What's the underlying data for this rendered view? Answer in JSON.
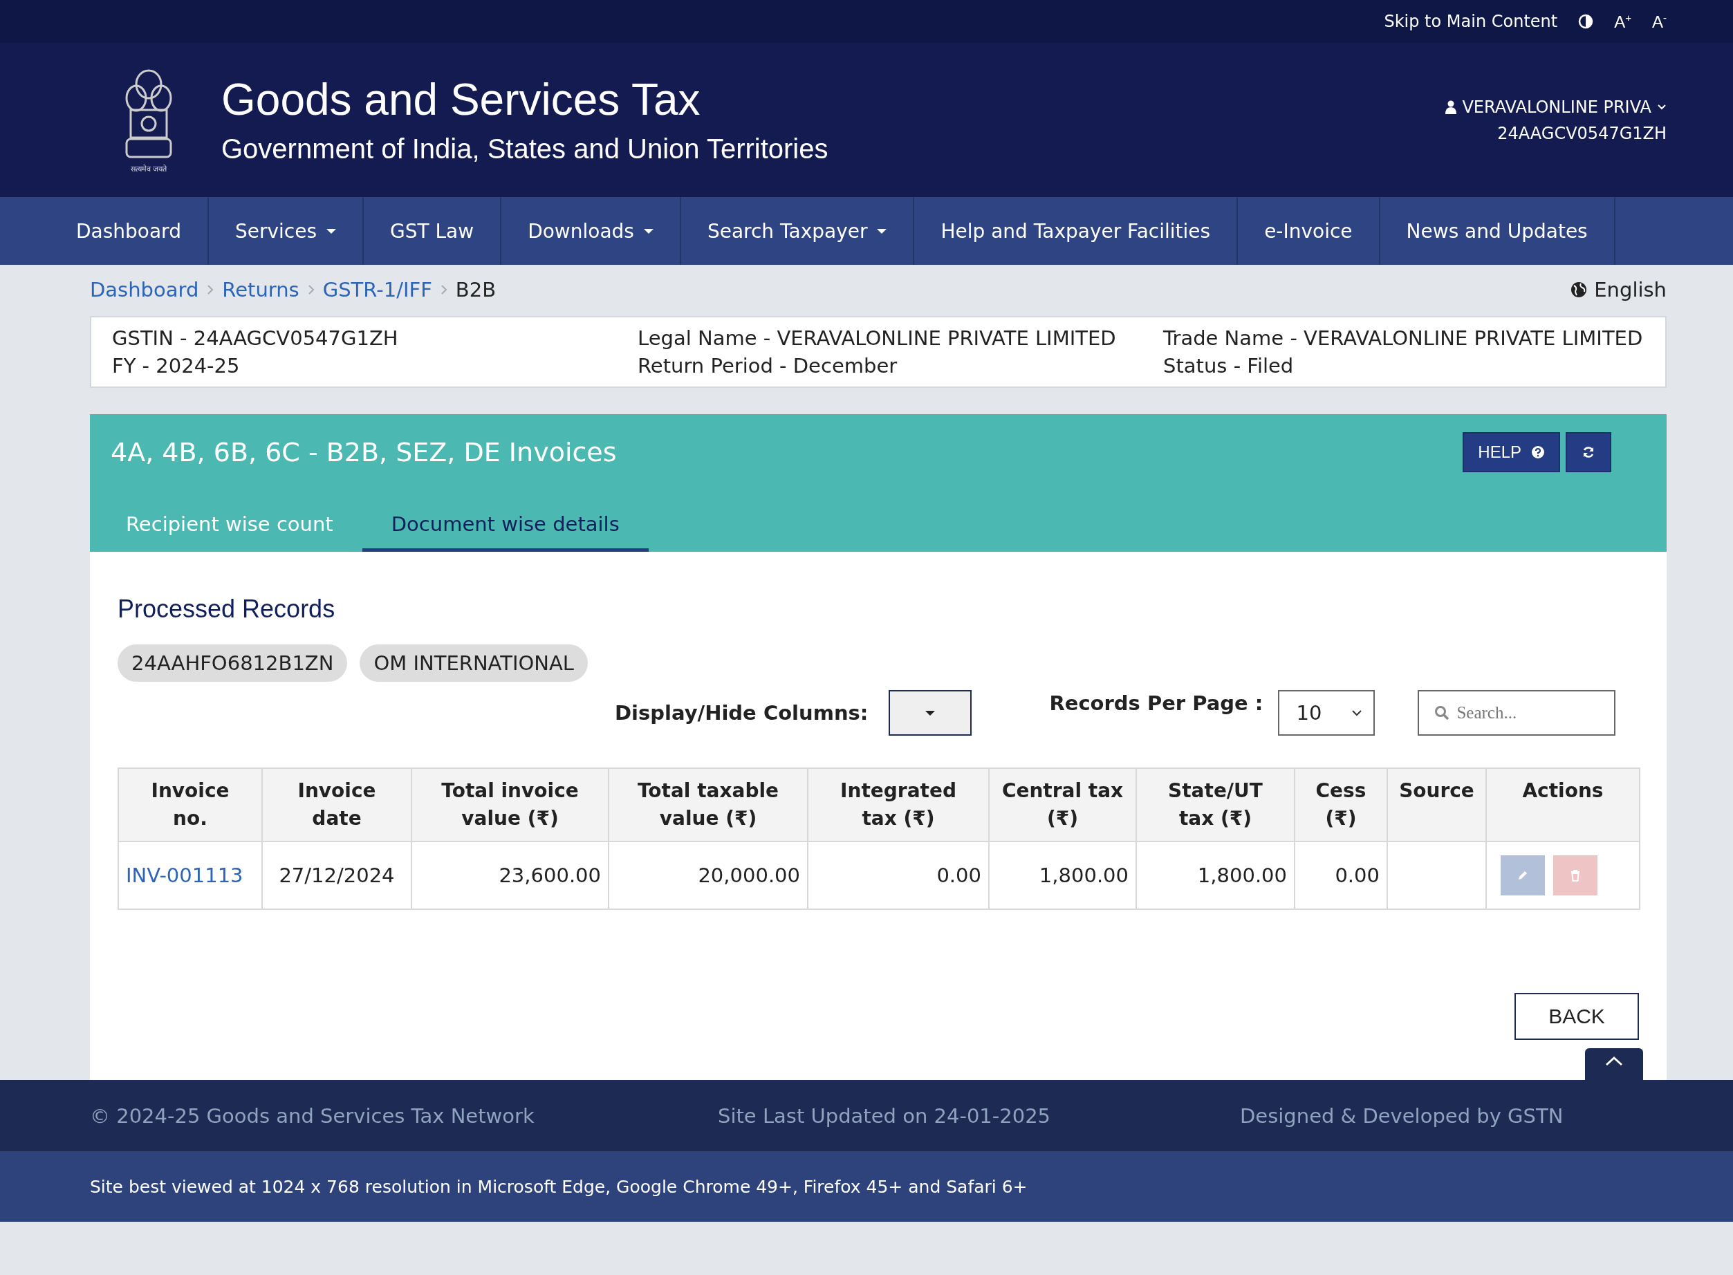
{
  "topbar": {
    "skip_link": "Skip to Main Content",
    "font_sizes": [
      "A$^{+}$",
      "A$^{-}$"
    ]
  },
  "header": {
    "emblem_caption": "सत्यमेव जयते",
    "title": "Goods and Services Tax",
    "subtitle": "Government of India, States and Union Territories",
    "user": {
      "name": "VERAVALONLINE PRIVA",
      "gstin": "24AAGCV0547G1ZH"
    }
  },
  "nav": [
    {
      "label": "Dashboard",
      "dropdown": false
    },
    {
      "label": "Services",
      "dropdown": true
    },
    {
      "label": "GST Law",
      "dropdown": false
    },
    {
      "label": "Downloads",
      "dropdown": true
    },
    {
      "label": "Search Taxpayer",
      "dropdown": true
    },
    {
      "label": "Help and Taxpayer Facilities",
      "dropdown": false
    },
    {
      "label": "e-Invoice",
      "dropdown": false
    },
    {
      "label": "News and Updates",
      "dropdown": false
    }
  ],
  "breadcrumb": {
    "links": [
      "Dashboard",
      "Returns",
      "GSTR-1/IFF"
    ],
    "current": "B2B",
    "language": "English"
  },
  "taxpayer_info": [
    [
      "GSTIN - 24AAGCV0547G1ZH",
      "FY - 2024-25"
    ],
    [
      "Legal Name - VERAVALONLINE PRIVATE LIMITED",
      "Return Period - December"
    ],
    [
      "Trade Name - VERAVALONLINE PRIVATE LIMITED",
      "Status - Filed"
    ]
  ],
  "section": {
    "title": "4A, 4B, 6B, 6C - B2B, SEZ, DE Invoices",
    "help_button": "HELP",
    "tabs": [
      {
        "label": "Recipient wise count",
        "selected": false
      },
      {
        "label": "Document wise details",
        "selected": true
      }
    ]
  },
  "records": {
    "heading": "Processed Records",
    "chips": [
      "24AAHFO6812B1ZN",
      "OM INTERNATIONAL"
    ],
    "display_hide_label": "Display/Hide Columns:",
    "records_per_page_label": "Records Per Page :",
    "records_per_page": "10",
    "search": {
      "placeholder": "Search..."
    }
  },
  "table": {
    "columns": [
      "Invoice no.",
      "Invoice date",
      "Total invoice value (₹)",
      "Total taxable value (₹)",
      "Integrated tax (₹)",
      "Central tax (₹)",
      "State/UT tax (₹)",
      "Cess (₹)",
      "Source",
      "Actions"
    ],
    "rows": [
      {
        "cells": [
          "INV-001113",
          "27/12/2024",
          "23,600.00",
          "20,000.00",
          "0.00",
          "1,800.00",
          "1,800.00",
          "0.00"
        ],
        "actions_disabled": true
      }
    ]
  },
  "back_button": "BACK",
  "footer": {
    "copyright": "© 2024-25 Goods and Services Tax Network",
    "updated": "Site Last Updated on 24-01-2025",
    "designed": "Designed & Developed by GSTN",
    "note": "Site best viewed at 1024 x 768 resolution in Microsoft Edge, Google Chrome 49+, Firefox 45+ and Safari 6+"
  }
}
